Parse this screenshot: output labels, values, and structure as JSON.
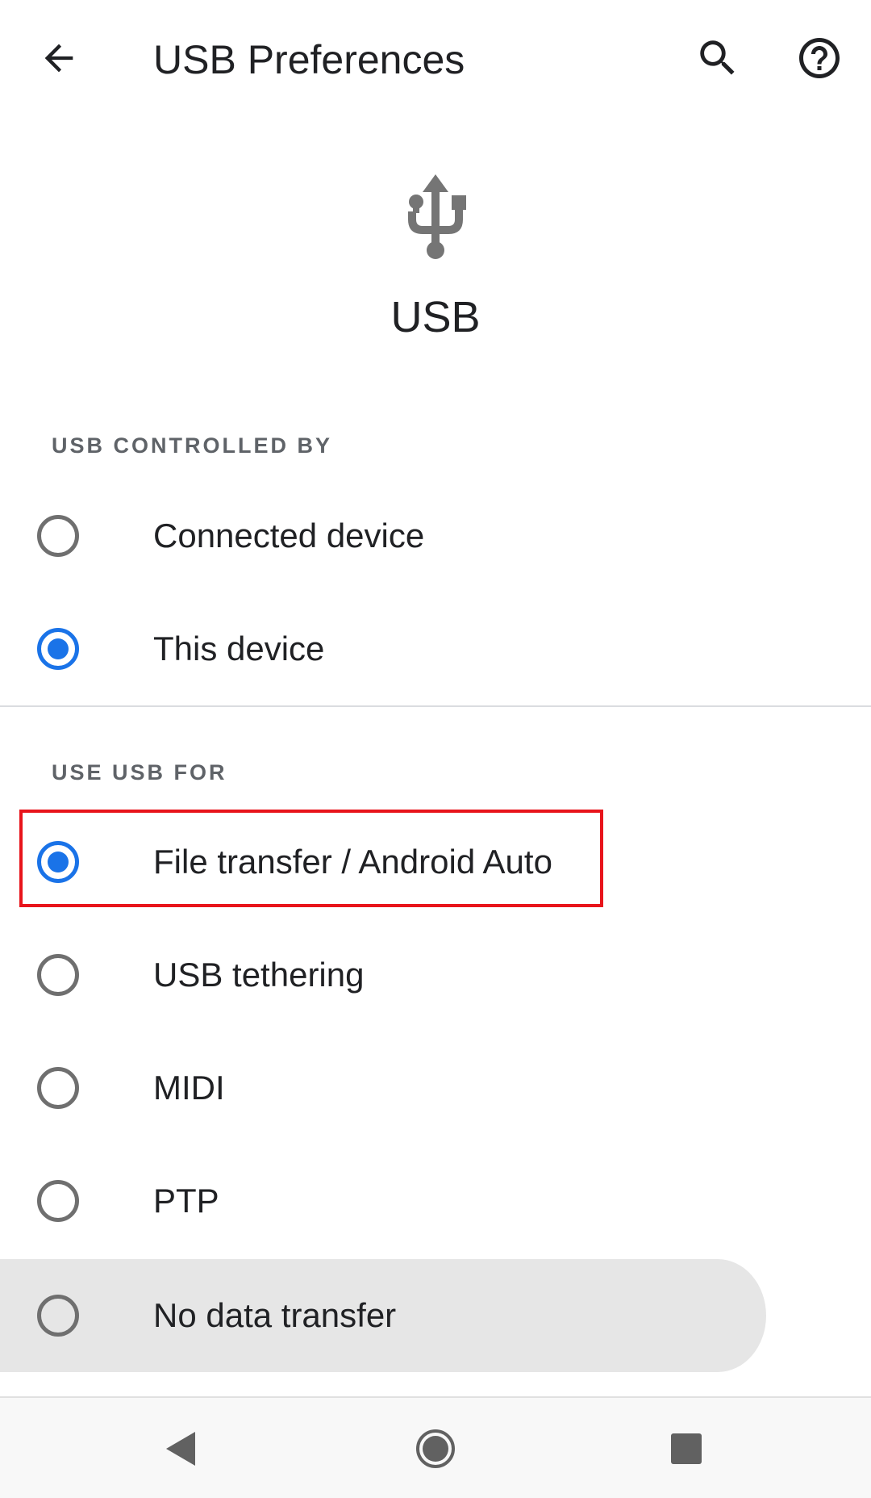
{
  "toolbar": {
    "title": "USB Preferences",
    "back_icon": "arrow-back-icon",
    "search_icon": "search-icon",
    "help_icon": "help-icon"
  },
  "header": {
    "icon": "usb-icon",
    "title": "USB"
  },
  "controlled_by": {
    "header": "USB CONTROLLED BY",
    "options": [
      {
        "label": "Connected device",
        "selected": false
      },
      {
        "label": "This device",
        "selected": true
      }
    ]
  },
  "use_usb_for": {
    "header": "USE USB FOR",
    "options": [
      {
        "label": "File transfer / Android Auto",
        "selected": true
      },
      {
        "label": "USB tethering",
        "selected": false
      },
      {
        "label": "MIDI",
        "selected": false
      },
      {
        "label": "PTP",
        "selected": false
      },
      {
        "label": "No data transfer",
        "selected": false
      }
    ]
  },
  "navbar": {
    "back_icon": "nav-back-icon",
    "home_icon": "nav-home-icon",
    "recents_icon": "nav-recents-icon"
  },
  "colors": {
    "accent": "#1a73e8",
    "highlight": "#e8141b",
    "icon_gray": "#757575"
  }
}
